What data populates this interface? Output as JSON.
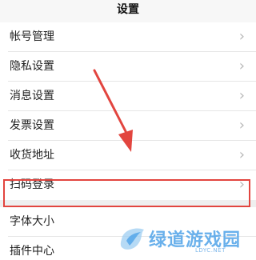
{
  "header": {
    "title": "设置"
  },
  "chevron_glyph": "›",
  "groups": [
    {
      "items": [
        {
          "label": "帐号管理"
        },
        {
          "label": "隐私设置"
        },
        {
          "label": "消息设置"
        },
        {
          "label": "发票设置"
        },
        {
          "label": "收货地址"
        },
        {
          "label": "扫码登录"
        }
      ]
    },
    {
      "items": [
        {
          "label": "字体大小"
        },
        {
          "label": "插件中心"
        }
      ]
    }
  ],
  "annotation": {
    "highlight_color": "#e2453f",
    "arrow_color": "#e2453f"
  },
  "watermark": {
    "text": "绿道游戏园",
    "url": "LDYC.NET",
    "color": "#4fa3e8"
  }
}
